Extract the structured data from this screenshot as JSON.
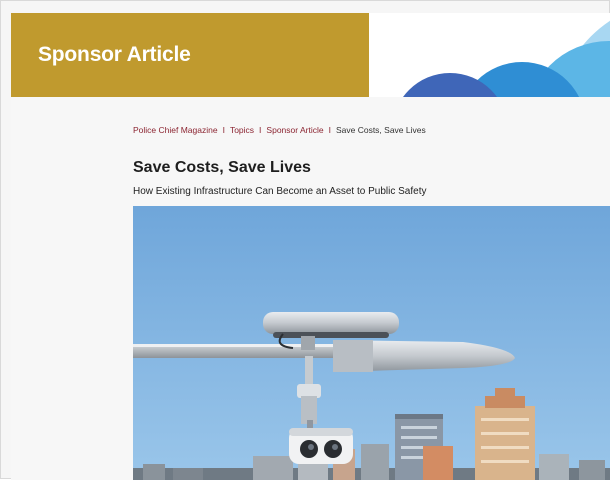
{
  "banner": {
    "title": "Sponsor Article"
  },
  "breadcrumb": {
    "items": [
      "Police Chief Magazine",
      "Topics",
      "Sponsor Article"
    ],
    "current": "Save Costs, Save Lives",
    "separator": "I"
  },
  "article": {
    "title": "Save Costs, Save Lives",
    "subtitle": "How Existing Infrastructure Can Become an Asset to Public Safety"
  },
  "colors": {
    "banner_gold": "#c09a2e",
    "link": "#8b2431",
    "sky": "#7fb0dc"
  }
}
